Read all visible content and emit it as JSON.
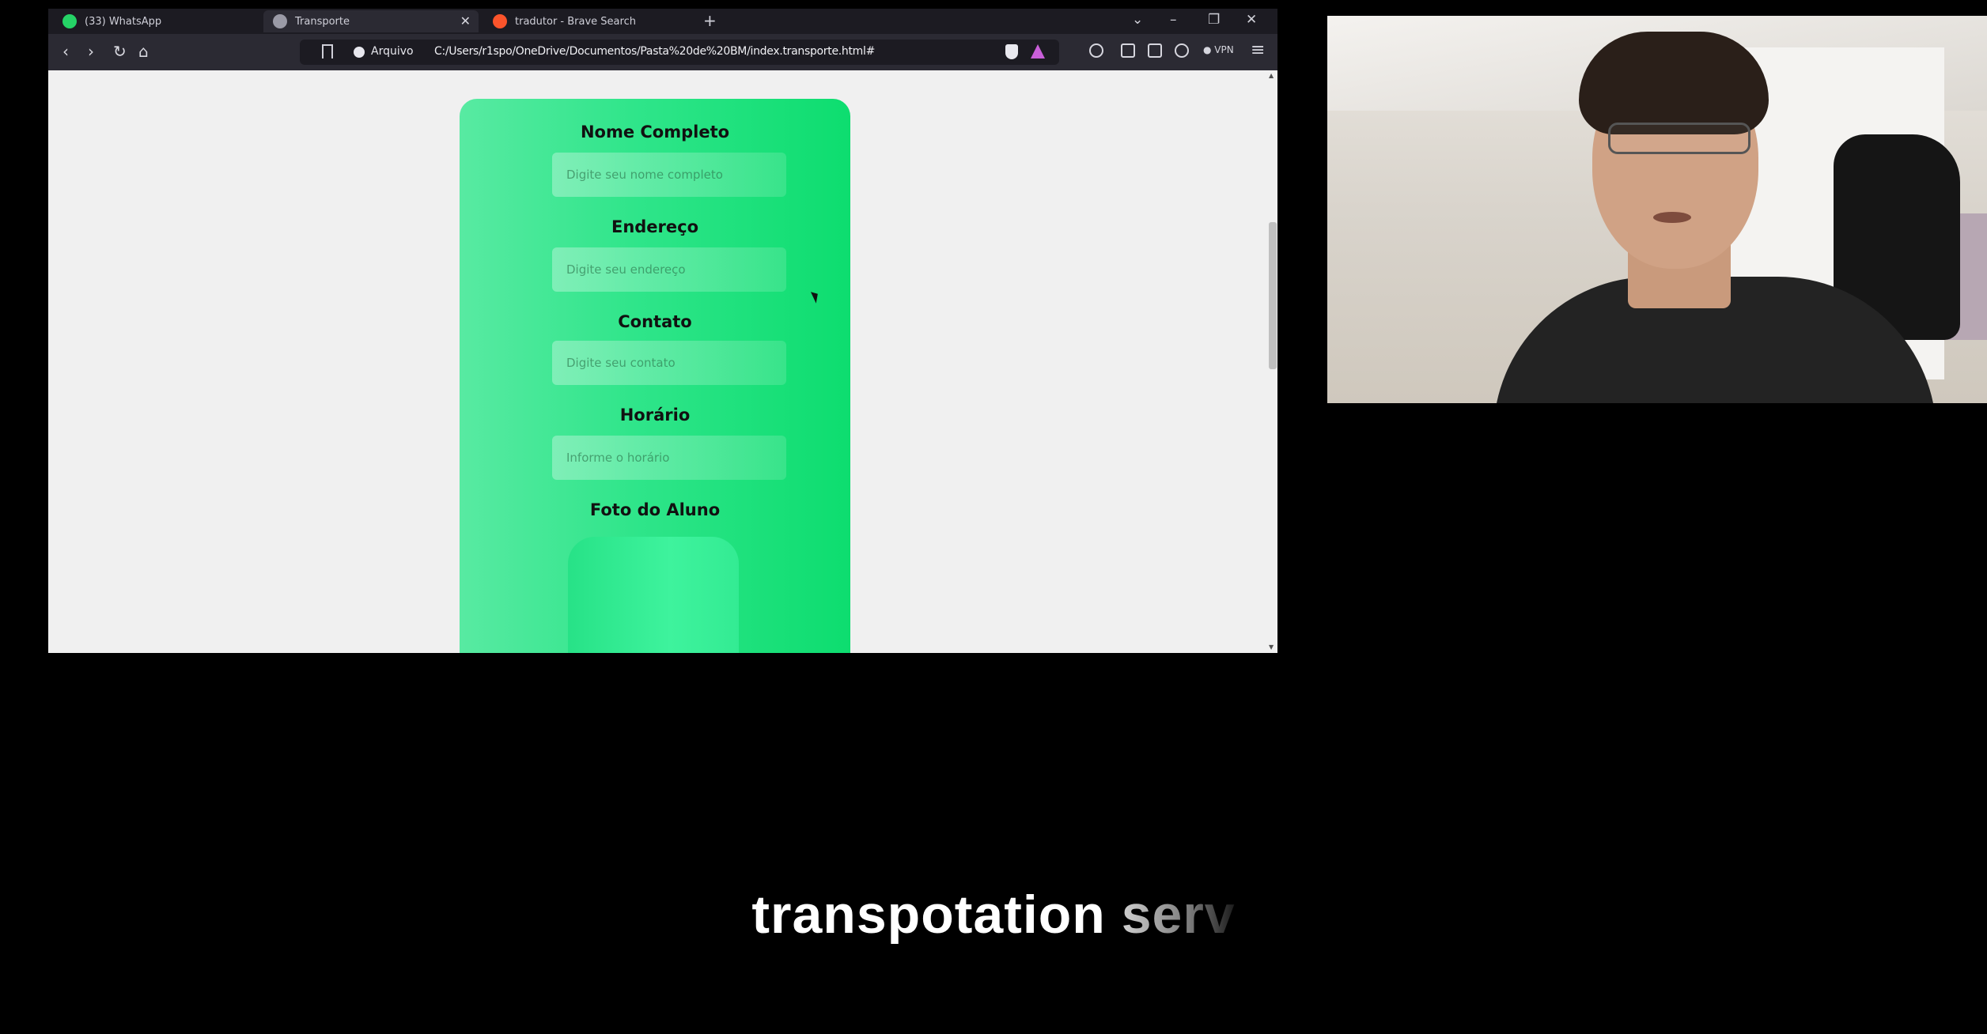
{
  "browser": {
    "tabs": [
      {
        "label": "(33) WhatsApp",
        "icon": "whatsapp-icon",
        "color": "#25d366"
      },
      {
        "label": "Transporte",
        "icon": "page-icon",
        "color": "#9a9aa6",
        "active": true
      },
      {
        "label": "tradutor - Brave Search",
        "icon": "brave-search-icon",
        "color": "#fb542b"
      }
    ],
    "url": {
      "scheme_label": "Arquivo",
      "path": "C:/Users/r1spo/OneDrive/Documentos/Pasta%20de%20BM/index.transporte.html#"
    },
    "vpn_label": "VPN"
  },
  "form": {
    "fields": [
      {
        "label": "Nome Completo",
        "placeholder": "Digite seu nome completo"
      },
      {
        "label": "Endereço",
        "placeholder": "Digite seu endereço"
      },
      {
        "label": "Contato",
        "placeholder": "Digite seu contato"
      },
      {
        "label": "Horário",
        "placeholder": "Informe o horário"
      }
    ],
    "photo_label": "Foto do Aluno"
  },
  "caption": {
    "main": "transpotation ",
    "fading": "serv"
  },
  "colors": {
    "card_gradient_start": "#58eaa2",
    "card_gradient_end": "#0ddd6f",
    "page_background": "#f0f0f0",
    "browser_chrome": "#2b2a33"
  }
}
